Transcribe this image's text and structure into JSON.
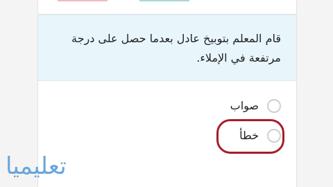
{
  "question": {
    "text": "قام المعلم بتوبيخ عادل بعدما حصل على درجة مرتفعة في الإملاء."
  },
  "options": [
    {
      "label": "صواب",
      "selected": false
    },
    {
      "label": "خطأ",
      "selected": false,
      "highlighted": true
    }
  ],
  "watermark": {
    "text": "تعليميا"
  },
  "colors": {
    "question_background": "#e8f5fa",
    "highlight_ring": "#a51d2d",
    "watermark": "#6aa6da"
  }
}
